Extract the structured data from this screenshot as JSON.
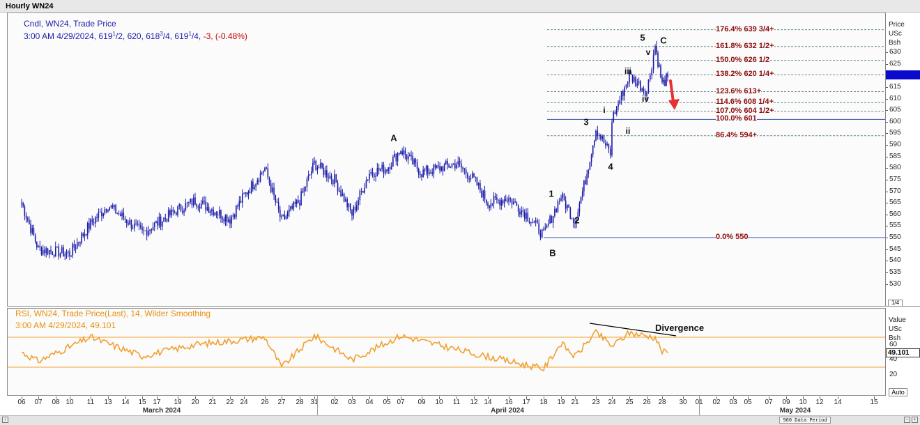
{
  "window": {
    "title": "Hourly WN24"
  },
  "legend": {
    "price_line1": "Cndl, WN24, Trade Price",
    "price_line2_prefix": "3:00 AM 4/29/2024, 619",
    "price_line2_mid": "/2, 620, 618",
    "price_line2_mid2": "/4, 619",
    "price_line2_end": "/4, ",
    "price_change": "-3, (-0.48%)",
    "sup1": "1",
    "sup3": "3",
    "sup1b": "1",
    "rsi_line1": "RSI, WN24, Trade Price(Last),  14, Wilder Smoothing",
    "rsi_line2": "3:00 AM 4/29/2024, 49.101"
  },
  "price_axis": {
    "header": [
      "Price",
      "USc",
      "Bsh"
    ],
    "labels": [
      "630",
      "625",
      "620",
      "615",
      "610",
      "605",
      "600",
      "595",
      "590",
      "585",
      "580",
      "575",
      "570",
      "565",
      "560",
      "555",
      "550",
      "545",
      "540",
      "535",
      "530"
    ],
    "scale_btn": "1/4"
  },
  "rsi_axis": {
    "header": [
      "Value",
      "USc",
      "Bsh"
    ],
    "labels": [
      "60",
      "40",
      "20"
    ],
    "current": "49.101",
    "auto_btn": "Auto"
  },
  "time_axis": {
    "day_labels": [
      "06",
      "07",
      "08",
      "10",
      "11",
      "13",
      "14",
      "15",
      "17",
      "19",
      "20",
      "21",
      "22",
      "24",
      "26",
      "27",
      "28",
      "31",
      "02",
      "03",
      "04",
      "05",
      "07",
      "09",
      "10",
      "11",
      "12",
      "14",
      "16",
      "17",
      "18",
      "19",
      "21",
      "23",
      "24",
      "25",
      "26",
      "28",
      "30",
      "01",
      "02",
      "03",
      "05",
      "07",
      "09",
      "10",
      "12",
      "14",
      "15"
    ],
    "month_labels": [
      "March 2024",
      "April 2024",
      "May 2024"
    ]
  },
  "bottom_bar": {
    "period": "960 Data Period"
  },
  "annotations": {
    "fib_labels": [
      "176.4% 639 3/4+",
      "161.8% 632 1/2+",
      "150.0% 626 1/2",
      "138.2% 620 1/4+",
      "123.6% 613+",
      "114.6% 608 1/4+",
      "107.0% 604 1/2+",
      "100.0% 601",
      "86.4%   594+",
      "0.0%     550"
    ],
    "waves": [
      "A",
      "B",
      "C",
      "1",
      "2",
      "3",
      "4",
      "5",
      "i",
      "ii",
      "iii",
      "iv",
      "v"
    ],
    "rsi_note": "Divergence"
  },
  "colors": {
    "candles": "#1a1aa8",
    "rsi": "#f0a030",
    "fib_text": "#8b0a0a",
    "arrow": "#e63232",
    "price_tag": "#0a0acd"
  },
  "chart_data": [
    {
      "type": "candlestick",
      "title": "Hourly WN24",
      "ylabel": "Price USc/Bsh",
      "ylim": [
        528,
        642
      ],
      "x_range": [
        "2024-03-06",
        "2024-05-15"
      ],
      "key_points": [
        {
          "x": "2024-03-06",
          "y": 565
        },
        {
          "x": "2024-03-07",
          "y": 545
        },
        {
          "x": "2024-03-10",
          "y": 543
        },
        {
          "x": "2024-03-11",
          "y": 556
        },
        {
          "x": "2024-03-13",
          "y": 564
        },
        {
          "x": "2024-03-15",
          "y": 552
        },
        {
          "x": "2024-03-19",
          "y": 562
        },
        {
          "x": "2024-03-20",
          "y": 566
        },
        {
          "x": "2024-03-22",
          "y": 558
        },
        {
          "x": "2024-03-24",
          "y": 568
        },
        {
          "x": "2024-03-25",
          "y": 580
        },
        {
          "x": "2024-03-27",
          "y": 557
        },
        {
          "x": "2024-03-28",
          "y": 566
        },
        {
          "x": "2024-03-31",
          "y": 582
        },
        {
          "x": "2024-04-02",
          "y": 575
        },
        {
          "x": "2024-04-03",
          "y": 560
        },
        {
          "x": "2024-04-04",
          "y": 578
        },
        {
          "x": "2024-04-05",
          "y": 580
        },
        {
          "x": "2024-04-07",
          "y": 588
        },
        {
          "x": "2024-04-09",
          "y": 578
        },
        {
          "x": "2024-04-11",
          "y": 582
        },
        {
          "x": "2024-04-12",
          "y": 575
        },
        {
          "x": "2024-04-14",
          "y": 565
        },
        {
          "x": "2024-04-16",
          "y": 567
        },
        {
          "x": "2024-04-17",
          "y": 560
        },
        {
          "x": "2024-04-18",
          "y": 551
        },
        {
          "x": "2024-04-19",
          "y": 568
        },
        {
          "x": "2024-04-21",
          "y": 557
        },
        {
          "x": "2024-04-22",
          "y": 575
        },
        {
          "x": "2024-04-23",
          "y": 597
        },
        {
          "x": "2024-04-24",
          "y": 585
        },
        {
          "x": "2024-04-24",
          "y": 601
        },
        {
          "x": "2024-04-25",
          "y": 620
        },
        {
          "x": "2024-04-26",
          "y": 613
        },
        {
          "x": "2024-04-27",
          "y": 633
        },
        {
          "x": "2024-04-28",
          "y": 616
        },
        {
          "x": "2024-04-29",
          "y": 619.25
        }
      ],
      "last": {
        "time": "3:00 AM 4/29/2024",
        "open": 619.5,
        "high": 620,
        "low": 618.75,
        "close": 619.25,
        "change": -3,
        "change_pct": -0.48
      },
      "fibonacci": [
        {
          "pct": "176.4%",
          "price": 639.75
        },
        {
          "pct": "161.8%",
          "price": 632.5
        },
        {
          "pct": "150.0%",
          "price": 626.5
        },
        {
          "pct": "138.2%",
          "price": 620.25
        },
        {
          "pct": "123.6%",
          "price": 613
        },
        {
          "pct": "114.6%",
          "price": 608.25
        },
        {
          "pct": "107.0%",
          "price": 604.5
        },
        {
          "pct": "100.0%",
          "price": 601
        },
        {
          "pct": "86.4%",
          "price": 594
        },
        {
          "pct": "0.0%",
          "price": 550
        }
      ]
    },
    {
      "type": "line",
      "title": "RSI, WN24, Trade Price(Last), 14, Wilder Smoothing",
      "ylim": [
        10,
        80
      ],
      "reference_lines": [
        70,
        30
      ],
      "key_points": [
        {
          "x": "2024-03-06",
          "y": 50
        },
        {
          "x": "2024-03-07",
          "y": 38
        },
        {
          "x": "2024-03-11",
          "y": 70
        },
        {
          "x": "2024-03-15",
          "y": 45
        },
        {
          "x": "2024-03-20",
          "y": 60
        },
        {
          "x": "2024-03-25",
          "y": 70
        },
        {
          "x": "2024-03-27",
          "y": 30
        },
        {
          "x": "2024-03-31",
          "y": 72
        },
        {
          "x": "2024-04-03",
          "y": 40
        },
        {
          "x": "2024-04-07",
          "y": 72
        },
        {
          "x": "2024-04-12",
          "y": 48
        },
        {
          "x": "2024-04-18",
          "y": 28
        },
        {
          "x": "2024-04-19",
          "y": 62
        },
        {
          "x": "2024-04-21",
          "y": 44
        },
        {
          "x": "2024-04-23",
          "y": 77
        },
        {
          "x": "2024-04-24",
          "y": 58
        },
        {
          "x": "2024-04-25",
          "y": 76
        },
        {
          "x": "2024-04-27",
          "y": 70
        },
        {
          "x": "2024-04-28",
          "y": 51
        },
        {
          "x": "2024-04-29",
          "y": 49.101
        }
      ]
    }
  ]
}
